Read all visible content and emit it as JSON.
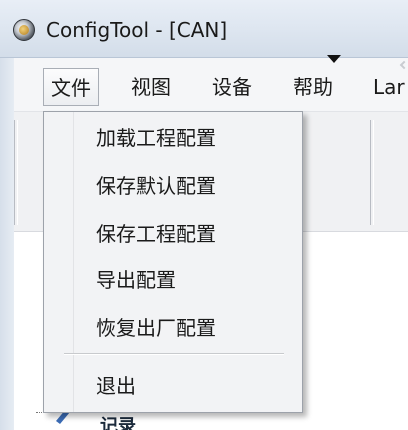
{
  "window": {
    "title": "ConfigTool - [CAN]",
    "icon": "app-globe-icon"
  },
  "menubar": {
    "items": [
      {
        "label": "文件",
        "open": true
      },
      {
        "label": "视图"
      },
      {
        "label": "设备"
      },
      {
        "label": "帮助"
      },
      {
        "label": "Lar"
      }
    ]
  },
  "file_menu": {
    "items": [
      {
        "label": "加载工程配置"
      },
      {
        "label": "保存默认配置"
      },
      {
        "label": "保存工程配置"
      },
      {
        "label": "导出配置"
      },
      {
        "label": "恢复出厂配置"
      },
      {
        "label": "退出"
      }
    ]
  },
  "tree": {
    "partial_label": "记录"
  },
  "colors": {
    "titlebar": "#dfe7f1",
    "menu_bg": "#f2f3f5",
    "menu_border": "#9da2aa"
  }
}
